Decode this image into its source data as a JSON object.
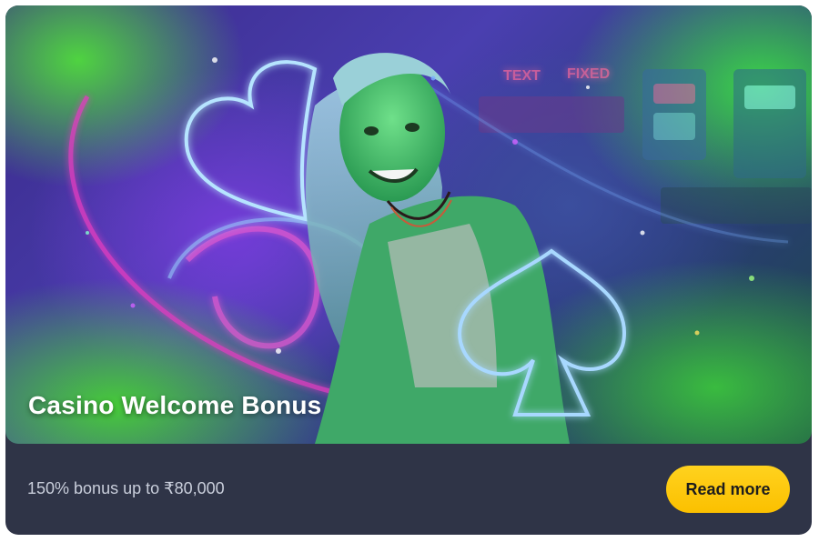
{
  "card": {
    "title": "Casino Welcome Bonus",
    "description": "150% bonus up to ₹80,000",
    "button_label": "Read more",
    "banner_signs": [
      "TEXT",
      "FIXED"
    ]
  },
  "colors": {
    "card_bg": "#2f3447",
    "button": "#fcc800",
    "neon_blue": "#8ecbff",
    "neon_pink": "#e23cc0",
    "green_glow": "#4bd63a"
  },
  "icons": [
    "neon-heart-icon",
    "neon-spade-icon"
  ]
}
